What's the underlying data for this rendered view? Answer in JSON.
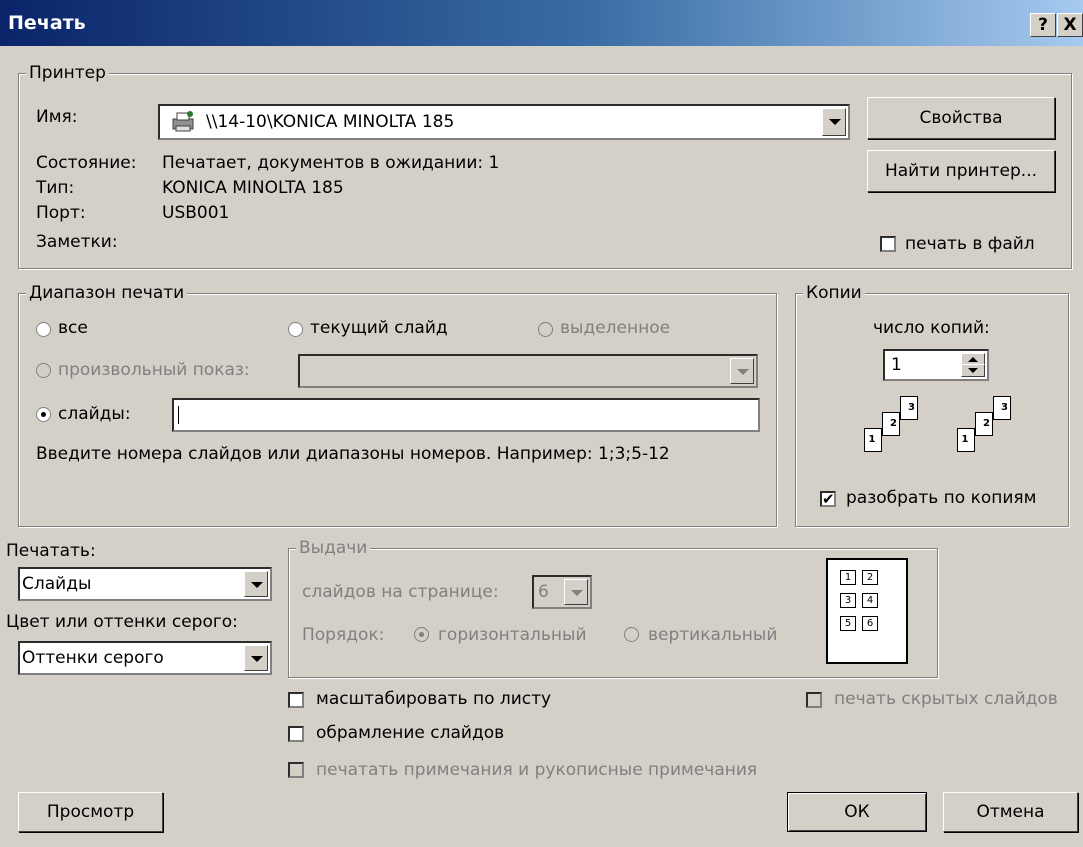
{
  "window": {
    "title": "Печать",
    "help_button": "?",
    "close_button": "X"
  },
  "printer": {
    "group_label": "Принтер",
    "name_label": "Имя:",
    "name_value": "\\\\14-10\\KONICA MINOLTA 185",
    "state_label": "Состояние:",
    "state_value": "Печатает, документов в ожидании: 1",
    "type_label": "Тип:",
    "type_value": "KONICA MINOLTA 185",
    "port_label": "Порт:",
    "port_value": "USB001",
    "notes_label": "Заметки:",
    "properties_button": "Свойства",
    "find_button": "Найти принтер...",
    "print_to_file": "печать в файл"
  },
  "range": {
    "group_label": "Диапазон печати",
    "all": "все",
    "current_slide": "текущий слайд",
    "selection": "выделенное",
    "custom_show": "произвольный показ:",
    "slides": "слайды:",
    "slides_value": "",
    "hint": "Введите номера слайдов или диапазоны номеров. Например: 1;3;5-12"
  },
  "copies": {
    "group_label": "Копии",
    "count_label": "число копий:",
    "count_value": "1",
    "collate": "разобрать по копиям",
    "page_numbers": [
      "1",
      "2",
      "3"
    ]
  },
  "print_what": {
    "label": "Печатать:",
    "value": "Слайды",
    "color_label": "Цвет или оттенки серого:",
    "color_value": "Оттенки серого"
  },
  "handouts": {
    "group_label": "Выдачи",
    "per_page_label": "слайдов на странице:",
    "per_page_value": "6",
    "order_label": "Порядок:",
    "horizontal": "горизонтальный",
    "vertical": "вертикальный",
    "preview_numbers": [
      "1",
      "2",
      "3",
      "4",
      "5",
      "6"
    ]
  },
  "options": {
    "scale": "масштабировать по листу",
    "frame": "обрамление слайдов",
    "notes": "печатать примечания и рукописные примечания",
    "hidden": "печать скрытых слайдов"
  },
  "buttons": {
    "preview": "Просмотр",
    "ok": "ОК",
    "cancel": "Отмена"
  }
}
